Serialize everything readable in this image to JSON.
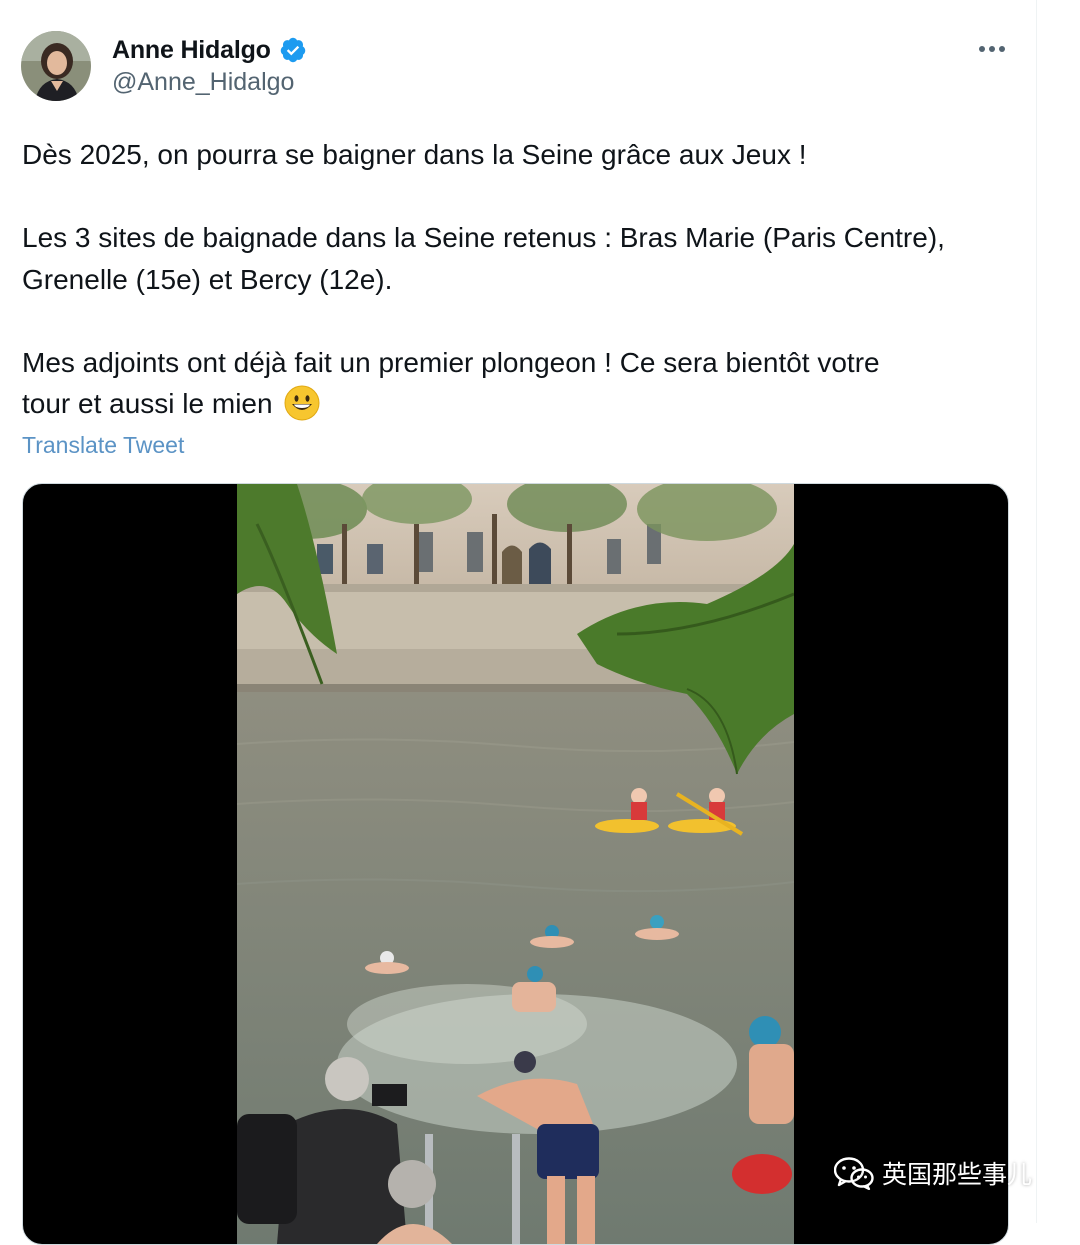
{
  "author": {
    "display_name": "Anne Hidalgo",
    "handle": "@Anne_Hidalgo",
    "verified": true
  },
  "tweet": {
    "paragraph_1": "Dès 2025, on pourra se baigner dans la Seine grâce aux Jeux !",
    "paragraph_2_line_1": "Les 3 sites de baignade dans la Seine retenus : Bras Marie (Paris Centre),",
    "paragraph_2_line_2": "Grenelle (15e) et Bercy (12e).",
    "paragraph_3_line_1": "Mes adjoints ont déjà fait un premier plongeon ! Ce sera bientôt votre",
    "paragraph_3_line_2": "tour et aussi le mien",
    "emoji": "grinning-face-emoji"
  },
  "actions": {
    "translate_label": "Translate Tweet",
    "more_icon": "more-horizontal-icon"
  },
  "media": {
    "type": "video",
    "subject": "swimmers-in-seine"
  },
  "watermark": {
    "text": "英国那些事儿",
    "icon": "wechat-icon"
  },
  "colors": {
    "text": "#0f1419",
    "secondary_text": "#536471",
    "link": "#5b93c5",
    "verified_badge": "#1d9bf0"
  }
}
